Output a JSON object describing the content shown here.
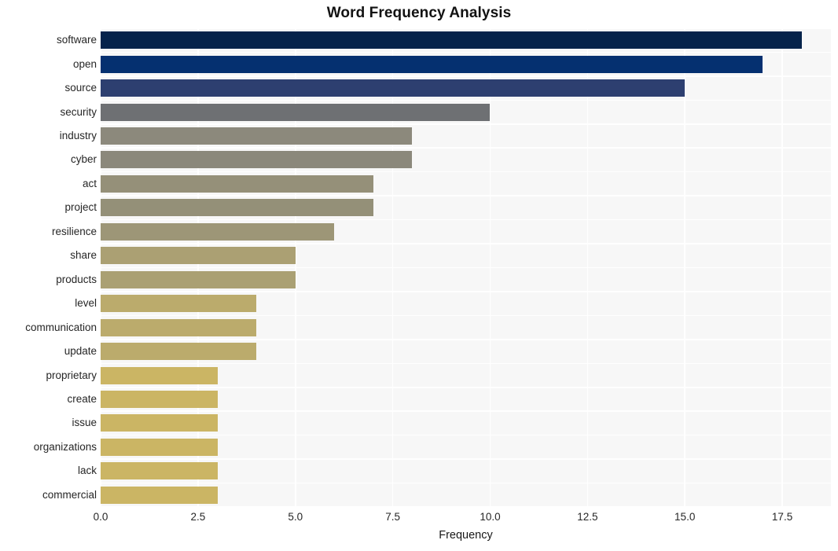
{
  "chart_data": {
    "type": "bar",
    "orientation": "horizontal",
    "title": "Word Frequency Analysis",
    "xlabel": "Frequency",
    "ylabel": "",
    "categories": [
      "software",
      "open",
      "source",
      "security",
      "industry",
      "cyber",
      "act",
      "project",
      "resilience",
      "share",
      "products",
      "level",
      "communication",
      "update",
      "proprietary",
      "create",
      "issue",
      "organizations",
      "lack",
      "commercial"
    ],
    "values": [
      18,
      17,
      15,
      10,
      8,
      8,
      7,
      7,
      6,
      5,
      5,
      4,
      4,
      4,
      3,
      3,
      3,
      3,
      3,
      3
    ],
    "bar_colors": [
      "#06234b",
      "#053070",
      "#2d3f70",
      "#6e7073",
      "#8c897c",
      "#8b887b",
      "#959079",
      "#949078",
      "#9d9677",
      "#aba073",
      "#aaa073",
      "#bbab6c",
      "#bbab6c",
      "#bbab6c",
      "#cbb564",
      "#cbb564",
      "#cbb564",
      "#cbb564",
      "#cbb564",
      "#cbb564"
    ],
    "xlim": [
      0,
      18.75
    ],
    "xticks": [
      0.0,
      2.5,
      5.0,
      7.5,
      10.0,
      12.5,
      15.0,
      17.5
    ],
    "xtick_labels": [
      "0.0",
      "2.5",
      "5.0",
      "7.5",
      "10.0",
      "12.5",
      "15.0",
      "17.5"
    ],
    "grid": true,
    "grid_color": "#ffffff",
    "plot_background": "#f7f7f7",
    "figure_background": "#ffffff",
    "legend": null
  }
}
